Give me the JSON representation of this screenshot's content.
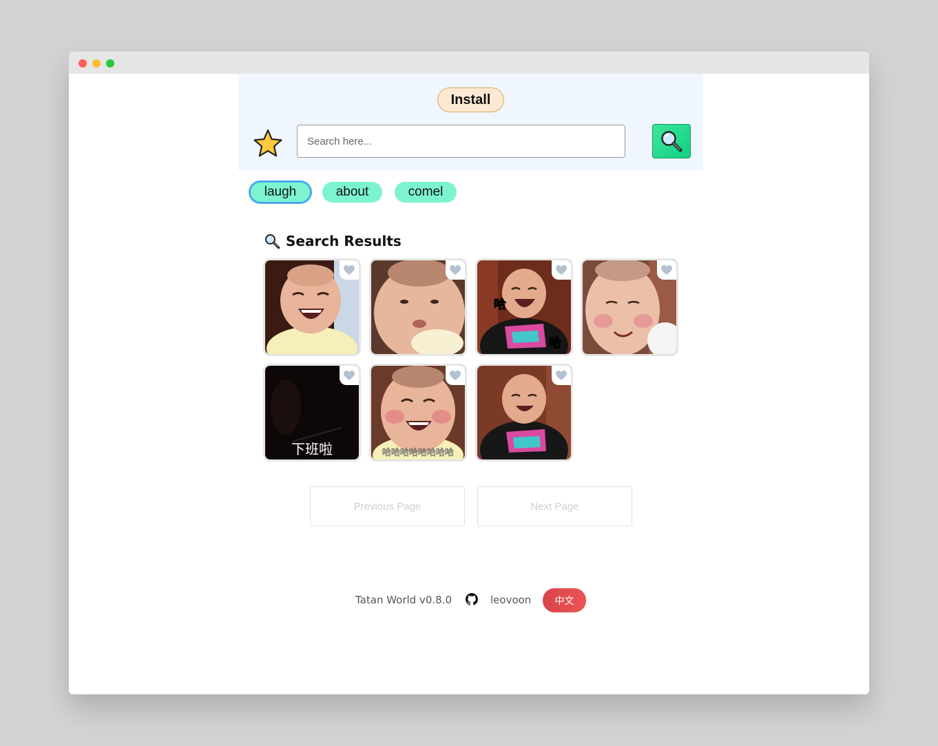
{
  "header": {
    "install_label": "Install",
    "search_placeholder": "Search here...",
    "search_value": ""
  },
  "tags": [
    {
      "label": "laugh",
      "active": true
    },
    {
      "label": "about",
      "active": false
    },
    {
      "label": "comel",
      "active": false
    }
  ],
  "results": {
    "title": "Search Results",
    "icon": "magnifier-icon",
    "items": [
      {
        "caption": ""
      },
      {
        "caption": ""
      },
      {
        "caption": "哈"
      },
      {
        "caption": ""
      },
      {
        "caption": "下班啦"
      },
      {
        "caption": "哈哈哈哈哈哈哈哈"
      },
      {
        "caption": ""
      }
    ]
  },
  "pagination": {
    "prev_label": "Previous Page",
    "next_label": "Next Page"
  },
  "footer": {
    "version_text": "Tatan World v0.8.0",
    "author": "leovoon",
    "lang_label": "中文"
  },
  "colors": {
    "tag_bg": "#7cf4cf",
    "tag_active_border": "#4aa9ef",
    "search_button": "#12d182",
    "lang_button": "#e04a4e",
    "header_panel": "#f0f6fd"
  }
}
